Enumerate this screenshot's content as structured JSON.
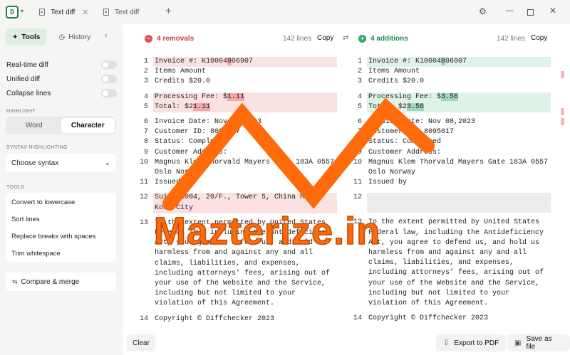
{
  "app": {
    "logo_letter": "D",
    "tabs": [
      {
        "label": "Text diff",
        "close": "✕"
      },
      {
        "label": "Text diff"
      }
    ],
    "new_tab": "+",
    "window": {
      "minimize": "—",
      "close": "✕",
      "settings": "⚙"
    }
  },
  "sidebar": {
    "tabs": [
      {
        "label": "Tools",
        "icon": "wand-icon",
        "glyph": "✦"
      },
      {
        "label": "History",
        "icon": "history-icon",
        "glyph": "◷"
      }
    ],
    "collapse": "‹",
    "toggles": [
      {
        "label": "Real-time diff",
        "on": false
      },
      {
        "label": "Unified diff",
        "on": false
      },
      {
        "label": "Collapse lines",
        "on": false
      }
    ],
    "highlight": {
      "label": "HIGHLIGHT",
      "options": [
        "Word",
        "Character"
      ],
      "selected": "Character"
    },
    "syntax": {
      "label": "SYNTAX HIGHLIGHTING",
      "value": "Choose syntax",
      "chevron": "⌄"
    },
    "tools": {
      "label": "TOOLS",
      "items": [
        "Convert to lowercase",
        "Sort lines",
        "Replace breaks with spaces",
        "Trim whitespace"
      ]
    },
    "compare_merge": {
      "label": "Compare & merge",
      "glyph": "⇆"
    },
    "clear": "Clear"
  },
  "left_pane": {
    "badge": "−",
    "summary": "4 removals",
    "lines": "142 lines",
    "copy": "Copy",
    "accent": "#e05252",
    "rows": [
      {
        "n": "1",
        "type": "del",
        "segs": [
          {
            "t": "Invoice #: K10004"
          },
          {
            "t": "9",
            "hl": true
          },
          {
            "t": "06907"
          }
        ]
      },
      {
        "n": "2",
        "segs": [
          {
            "t": "Items Amount"
          }
        ]
      },
      {
        "n": "3",
        "segs": [
          {
            "t": "Credits $20.0"
          }
        ]
      },
      {
        "n": "4",
        "type": "del",
        "segs": [
          {
            "t": "Processing Fee: $"
          },
          {
            "t": "1.11",
            "hl": true
          }
        ]
      },
      {
        "n": "5",
        "type": "del",
        "segs": [
          {
            "t": "Total: $2"
          },
          {
            "t": "1.11",
            "hl": true
          }
        ]
      },
      {
        "n": "6",
        "segs": [
          {
            "t": "Invoice Date: Nov 08,2023"
          }
        ]
      },
      {
        "n": "7",
        "segs": [
          {
            "t": "Customer ID: 8095017"
          }
        ]
      },
      {
        "n": "8",
        "segs": [
          {
            "t": "Status: Completed"
          }
        ]
      },
      {
        "n": "9",
        "segs": [
          {
            "t": "Customer Address:"
          }
        ]
      },
      {
        "n": "10",
        "segs": [
          {
            "t": "Magnus Klem Thorvald Mayers Gate 183A 0557 Oslo Norway"
          }
        ]
      },
      {
        "n": "11",
        "segs": [
          {
            "t": "Issued by"
          }
        ]
      },
      {
        "n": "12",
        "type": "del",
        "segs": [
          {
            "t": "Suite 2004, 20/F., Tower 5, China Hong Kong City"
          }
        ]
      },
      {
        "n": "13",
        "segs": [
          {
            "t": "To the extent permitted by United States Federal law, including the Antideficiency Act, you agree to defend us, and hold us harmless from and against any and all claims, liabilities, and expenses, including attorneys' fees, arising out of your use of the Website and the Service, including but not limited to your violation of this Agreement."
          }
        ]
      },
      {
        "n": "14",
        "segs": [
          {
            "t": "Copyright © Diffchecker 2023"
          }
        ]
      }
    ]
  },
  "right_pane": {
    "badge": "+",
    "summary": "4 additions",
    "lines": "142 lines",
    "copy": "Copy",
    "accent": "#2fa86a",
    "rows": [
      {
        "n": "1",
        "type": "add",
        "segs": [
          {
            "t": "Invoice #: K10004"
          },
          {
            "t": "8",
            "hl": true
          },
          {
            "t": "06907"
          }
        ]
      },
      {
        "n": "2",
        "segs": [
          {
            "t": "Items Amount"
          }
        ]
      },
      {
        "n": "3",
        "segs": [
          {
            "t": "Credits $20.0"
          }
        ]
      },
      {
        "n": "4",
        "type": "add",
        "segs": [
          {
            "t": "Processing Fee: $"
          },
          {
            "t": "3.56",
            "hl": true
          }
        ]
      },
      {
        "n": "5",
        "type": "add",
        "segs": [
          {
            "t": "Total: $2"
          },
          {
            "t": "3.56",
            "hl": true
          }
        ]
      },
      {
        "n": "6",
        "segs": [
          {
            "t": "Invoice Date: Nov 08,2023"
          }
        ]
      },
      {
        "n": "7",
        "segs": [
          {
            "t": "Customer ID: 8095017"
          }
        ]
      },
      {
        "n": "8",
        "segs": [
          {
            "t": "Status: Completed"
          }
        ]
      },
      {
        "n": "9",
        "segs": [
          {
            "t": "Customer Address:"
          }
        ]
      },
      {
        "n": "10",
        "segs": [
          {
            "t": "Magnus Klem Thorvald Mayers Gate 183A 0557 Oslo Norway"
          }
        ]
      },
      {
        "n": "11",
        "segs": [
          {
            "t": "Issued by"
          }
        ]
      },
      {
        "n": "12",
        "type": "empty",
        "segs": [
          {
            "t": ""
          }
        ]
      },
      {
        "n": "13",
        "segs": [
          {
            "t": "To the extent permitted by United States Federal law, including the Antideficiency Act, you agree to defend us, and hold us harmless from and against any and all claims, liabilities, and expenses, including attorneys' fees, arising out of your use of the Website and the Service, including but not limited to your violation of this Agreement."
          }
        ]
      },
      {
        "n": "14",
        "segs": [
          {
            "t": "Copyright © Diffchecker 2023"
          }
        ]
      }
    ]
  },
  "swap": "⇄",
  "footer": {
    "export": {
      "label": "Export to PDF",
      "glyph": "⇩"
    },
    "save": {
      "label": "Save as file",
      "glyph": "▣"
    }
  },
  "watermark": {
    "text": "Mazterize.in",
    "color": "#ff6b0a"
  }
}
